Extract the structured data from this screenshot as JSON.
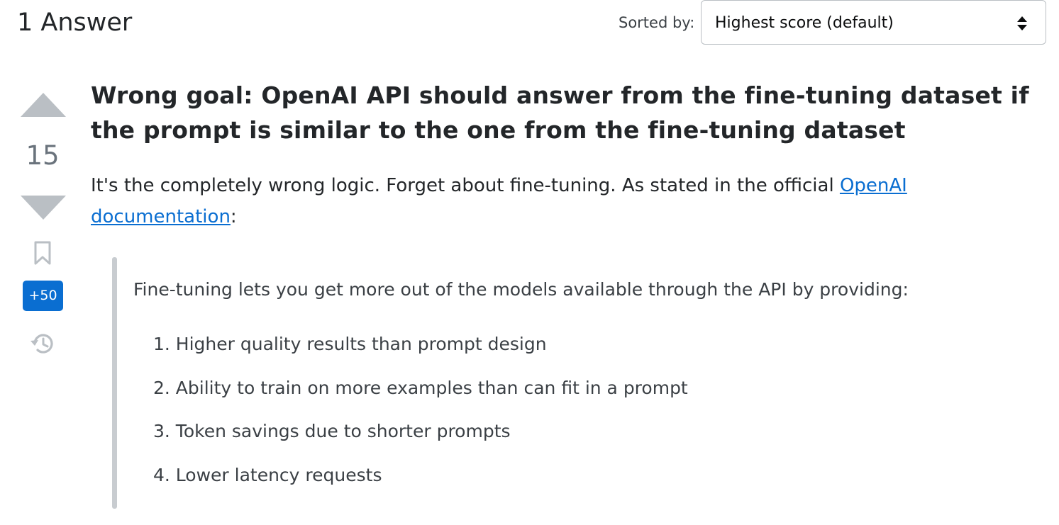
{
  "header": {
    "answers_count": "1 Answer",
    "sort_label": "Sorted by:",
    "sort_value": "Highest score (default)"
  },
  "vote": {
    "score": "15",
    "bounty": "+50"
  },
  "post": {
    "heading": "Wrong goal: OpenAI API should answer from the fine-tuning dataset if the prompt is similar to the one from the fine-tuning dataset",
    "intro_text": "It's the completely wrong logic. Forget about fine-tuning. As stated in the official ",
    "intro_link": "OpenAI documentation",
    "intro_end": ":",
    "quote": {
      "text": "Fine-tuning lets you get more out of the models available through the API by providing:",
      "items": [
        "1. Higher quality results than prompt design",
        "2. Ability to train on more examples than can fit in a prompt",
        "3. Token savings due to shorter prompts",
        "4. Lower latency requests"
      ]
    }
  },
  "colors": {
    "link": "#0a6ed1",
    "bounty_badge": "#0a6ed1",
    "vote_arrow": "#babfc4",
    "quote_bar": "#c8ccd0"
  },
  "icons": {
    "sort": "sort-arrows-icon",
    "upvote": "upvote-arrow-icon",
    "downvote": "downvote-arrow-icon",
    "bookmark": "bookmark-icon",
    "history": "history-icon"
  }
}
